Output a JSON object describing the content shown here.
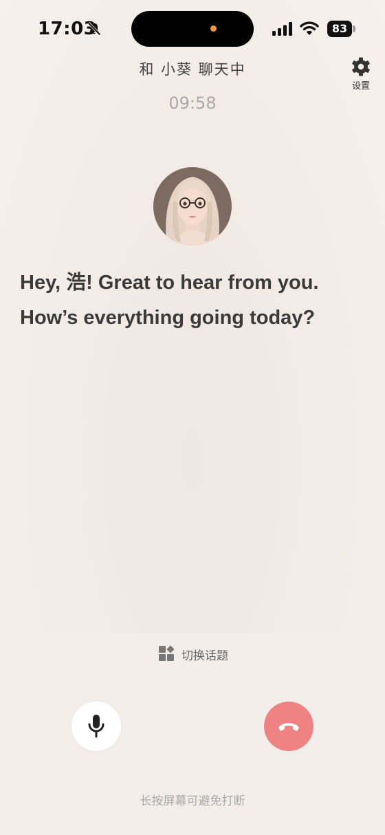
{
  "status_bar": {
    "time": "17:03",
    "battery": "83",
    "icons": [
      "bell-slash-icon",
      "signal-icon",
      "wifi-icon",
      "battery-icon"
    ]
  },
  "header": {
    "title": "和 小葵 聊天中",
    "timer": "09:58",
    "settings_label": "设置",
    "settings_icon": "gear-icon"
  },
  "message": {
    "text": "Hey, 浩! Great to hear from you. How’s everything going today?"
  },
  "controls": {
    "switch_topic_label": "切换话题",
    "switch_topic_icon": "widgets-icon",
    "mic_icon": "microphone-icon",
    "hangup_icon": "phone-hangup-icon",
    "hint": "长按屏幕可避免打断"
  },
  "colors": {
    "hangup": "#ef8282",
    "background": "#f3ece7",
    "status_dot": "#f39a3a"
  }
}
